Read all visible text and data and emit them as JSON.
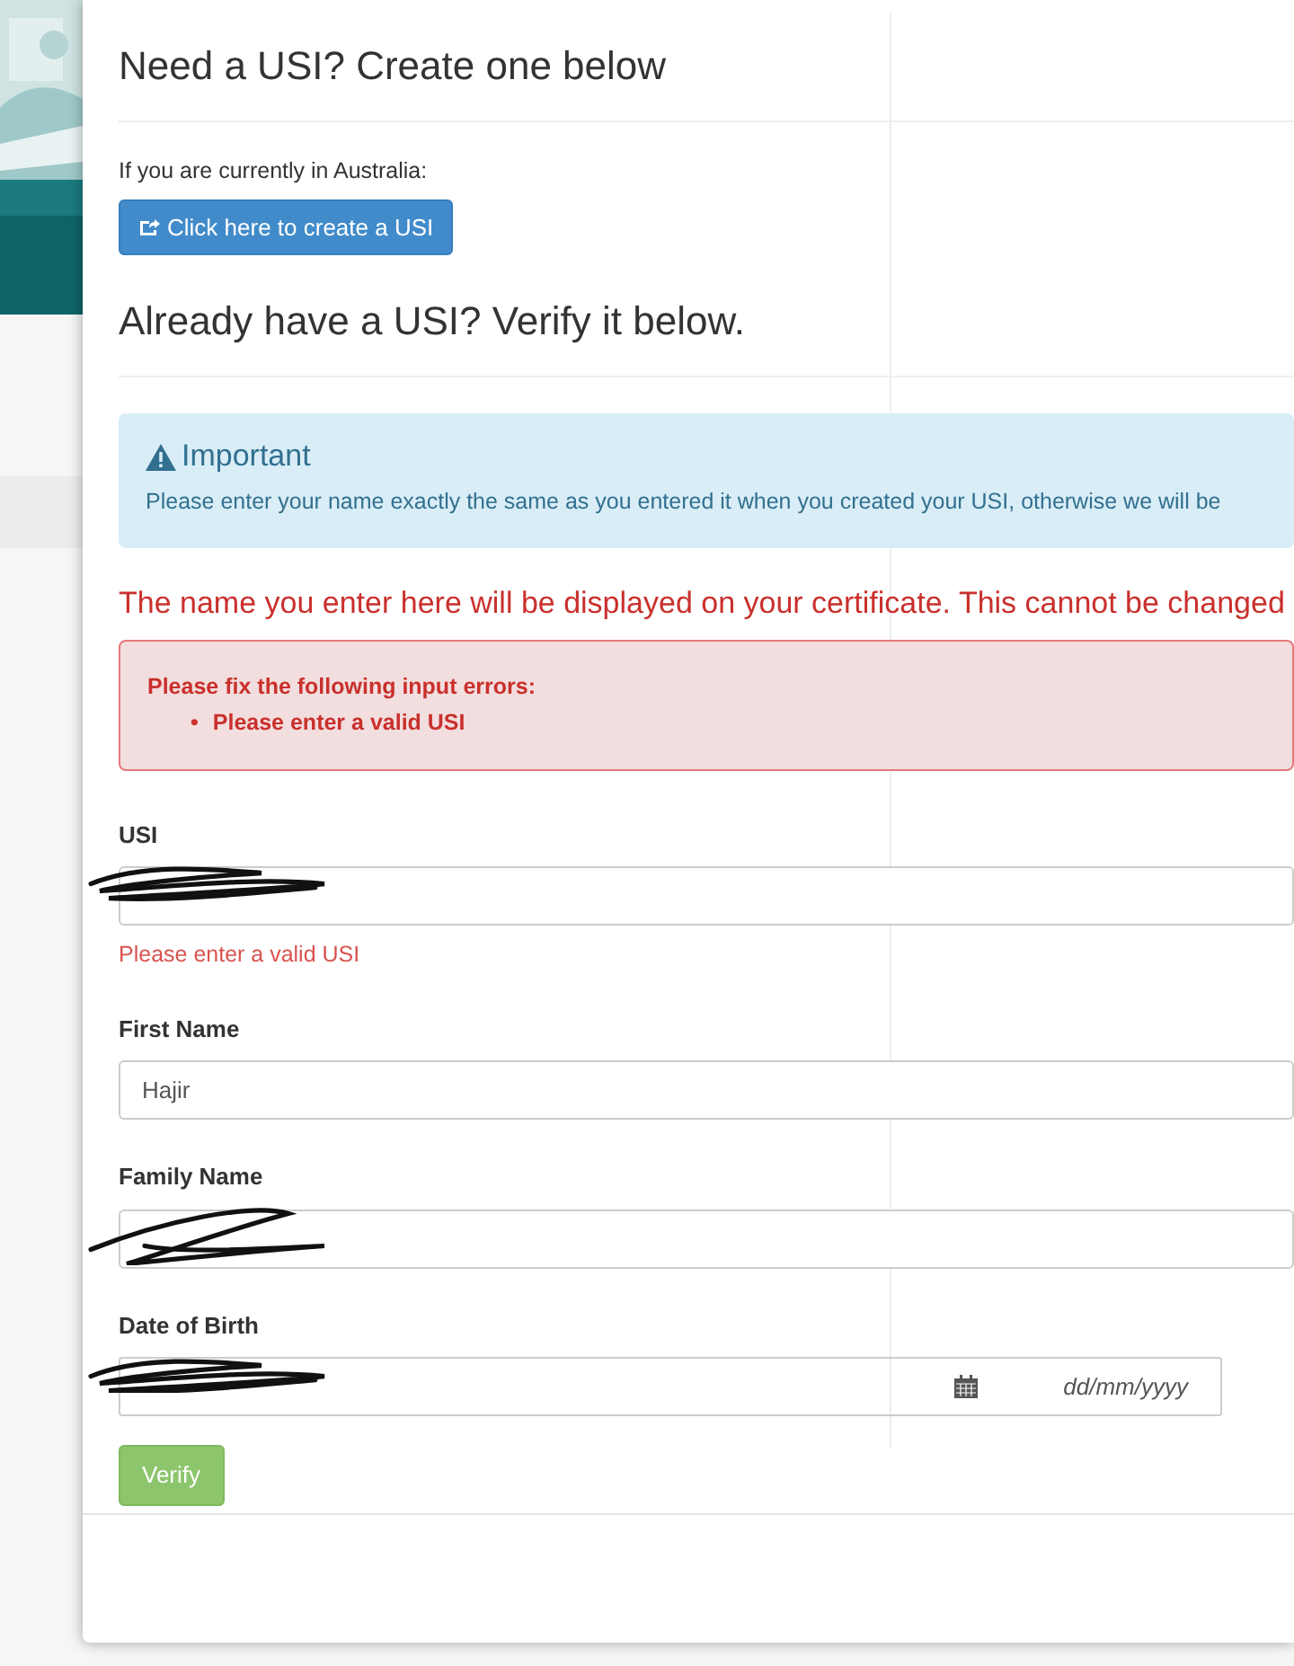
{
  "create_section": {
    "title": "Need a USI? Create one below",
    "note": "If you are currently in Australia:",
    "button": "Click here to create a USI"
  },
  "verify_section": {
    "title": "Already have a USI? Verify it below.",
    "info_alert": {
      "title": "Important",
      "text": "Please enter your name exactly the same as you entered it when you created your USI, otherwise we will be"
    },
    "warning": "The name you enter here will be displayed on your certificate. This cannot be changed",
    "error_alert": {
      "title": "Please fix the following input errors:",
      "bullet": "•",
      "items": [
        "Please enter a valid USI"
      ]
    },
    "fields": [
      {
        "label": "USI",
        "kind": "text",
        "redacted": true,
        "error": "Please enter a valid USI"
      },
      {
        "label": "First Name",
        "kind": "text",
        "value": "Hajir",
        "redacted": false
      },
      {
        "label": "Family Name",
        "kind": "text",
        "redacted": true
      },
      {
        "label": "Date of Birth",
        "kind": "date",
        "redacted": true,
        "format": "dd/mm/yyyy"
      }
    ],
    "button": {
      "label": "Verify",
      "disabled": true
    }
  }
}
